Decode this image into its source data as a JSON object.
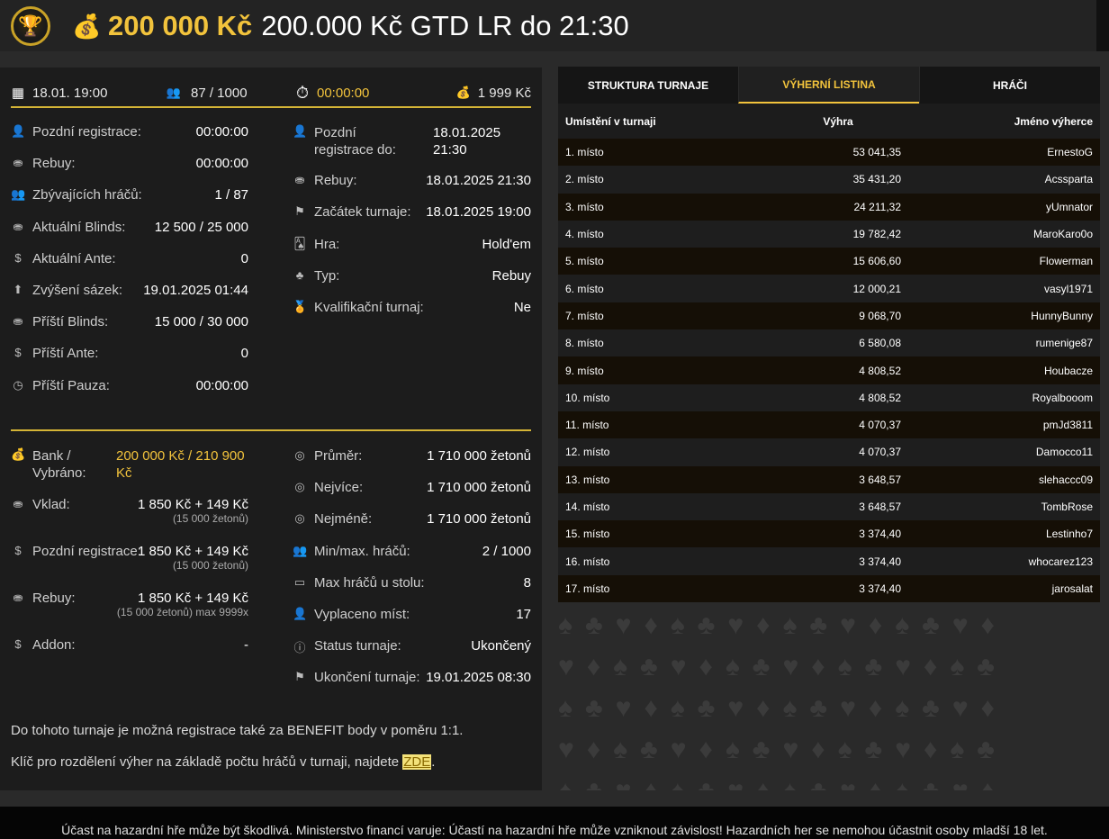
{
  "header": {
    "prize": "200 000 Kč",
    "title": "200.000 Kč GTD LR do 21:30"
  },
  "summary": {
    "date": "18.01. 19:00",
    "players": "87 / 1000",
    "timer": "00:00:00",
    "buyin": "1 999 Kč"
  },
  "info_left": [
    {
      "label": "Pozdní registrace:",
      "value": "00:00:00",
      "icon": "user-icon"
    },
    {
      "label": "Rebuy:",
      "value": "00:00:00",
      "icon": "coins-icon"
    },
    {
      "label": "Zbývajících hráčů:",
      "value": "1 / 87",
      "icon": "users-icon"
    },
    {
      "label": "Aktuální Blinds:",
      "value": "12 500 / 25 000",
      "icon": "coins-icon"
    },
    {
      "label": "Aktuální Ante:",
      "value": "0",
      "icon": "dollar-icon"
    },
    {
      "label": "Zvýšení sázek:",
      "value": "19.01.2025 01:44",
      "icon": "arrow-up-icon"
    },
    {
      "label": "Příští Blinds:",
      "value": "15 000 / 30 000",
      "icon": "coins-icon"
    },
    {
      "label": "Příští Ante:",
      "value": "0",
      "icon": "dollar-icon"
    },
    {
      "label": "Příští Pauza:",
      "value": "00:00:00",
      "icon": "clock-icon"
    }
  ],
  "info_right": [
    {
      "label": "Pozdní registrace do:",
      "value": "18.01.2025 21:30",
      "icon": "user-icon"
    },
    {
      "label": "Rebuy:",
      "value": "18.01.2025 21:30",
      "icon": "coins-icon"
    },
    {
      "label": "Začátek turnaje:",
      "value": "18.01.2025 19:00",
      "icon": "flag-icon"
    },
    {
      "label": "Hra:",
      "value": "Hold'em",
      "icon": "cards-icon"
    },
    {
      "label": "Typ:",
      "value": "Rebuy",
      "icon": "suits-icon"
    },
    {
      "label": "Kvalifikační turnaj:",
      "value": "Ne",
      "icon": "medal-icon"
    }
  ],
  "bank": {
    "label": "Bank / Vybráno:",
    "value": "200 000 Kč / 210 900 Kč",
    "deposit_label": "Vklad:",
    "deposit_value": "1 850 Kč + 149 Kč",
    "deposit_sub": "(15 000 žetonů)",
    "late_label": "Pozdní registrace:",
    "late_value": "1 850 Kč + 149 Kč",
    "late_sub": "(15 000 žetonů)",
    "rebuy_label": "Rebuy:",
    "rebuy_value": "1 850 Kč + 149 Kč",
    "rebuy_sub": "(15 000 žetonů) max 9999x",
    "addon_label": "Addon:",
    "addon_value": "-"
  },
  "stats_right": [
    {
      "label": "Průměr:",
      "value": "1 710 000 žetonů",
      "icon": "chip-icon"
    },
    {
      "label": "Nejvíce:",
      "value": "1 710 000 žetonů",
      "icon": "chip-icon"
    },
    {
      "label": "Nejméně:",
      "value": "1 710 000 žetonů",
      "icon": "chip-icon"
    },
    {
      "label": "Min/max. hráčů:",
      "value": "2 / 1000",
      "icon": "users-icon"
    },
    {
      "label": "Max hráčů u stolu:",
      "value": "8",
      "icon": "table-icon"
    },
    {
      "label": "Vyplaceno míst:",
      "value": "17",
      "icon": "payout-icon"
    },
    {
      "label": "Status turnaje:",
      "value": "Ukončený",
      "icon": "info-icon"
    },
    {
      "label": "Ukončení turnaje:",
      "value": "19.01.2025 08:30",
      "icon": "flag-icon"
    }
  ],
  "notes": {
    "benefit": "Do tohoto turnaje je možná registrace také za BENEFIT body v poměru 1:1.",
    "key_text": "Klíč pro rozdělení výher na základě počtu hráčů v turnaji, najdete ",
    "key_link": "ZDE",
    "key_end": "."
  },
  "tabs": [
    "STRUKTURA TURNAJE",
    "VÝHERNÍ LISTINA",
    "HRÁČI"
  ],
  "table": {
    "headers": [
      "Umístění v turnaji",
      "Výhra",
      "Jméno výherce"
    ],
    "rows": [
      [
        "1. místo",
        "53 041,35",
        "ErnestoG"
      ],
      [
        "2. místo",
        "35 431,20",
        "Acssparta"
      ],
      [
        "3. místo",
        "24 211,32",
        "yUmnator"
      ],
      [
        "4. místo",
        "19 782,42",
        "MaroKaro0o"
      ],
      [
        "5. místo",
        "15 606,60",
        "Flowerman"
      ],
      [
        "6. místo",
        "12 000,21",
        "vasyl1971"
      ],
      [
        "7. místo",
        "9 068,70",
        "HunnyBunny"
      ],
      [
        "8. místo",
        "6 580,08",
        "rumenige87"
      ],
      [
        "9. místo",
        "4 808,52",
        "Houbacze"
      ],
      [
        "10. místo",
        "4 808,52",
        "Royalbooom"
      ],
      [
        "11. místo",
        "4 070,37",
        "pmJd3811"
      ],
      [
        "12. místo",
        "4 070,37",
        "Damocco11"
      ],
      [
        "13. místo",
        "3 648,57",
        "slehaccc09"
      ],
      [
        "14. místo",
        "3 648,57",
        "TombRose"
      ],
      [
        "15. místo",
        "3 374,40",
        "Lestinho7"
      ],
      [
        "16. místo",
        "3 374,40",
        "whocarez123"
      ],
      [
        "17. místo",
        "3 374,40",
        "jarosalat"
      ]
    ]
  },
  "footer": "Účast na hazardní hře může být škodlivá. Ministerstvo financí varuje: Účastí na hazardní hře může vzniknout závislost! Hazardních her se nemohou účastnit osoby mladší 18 let."
}
